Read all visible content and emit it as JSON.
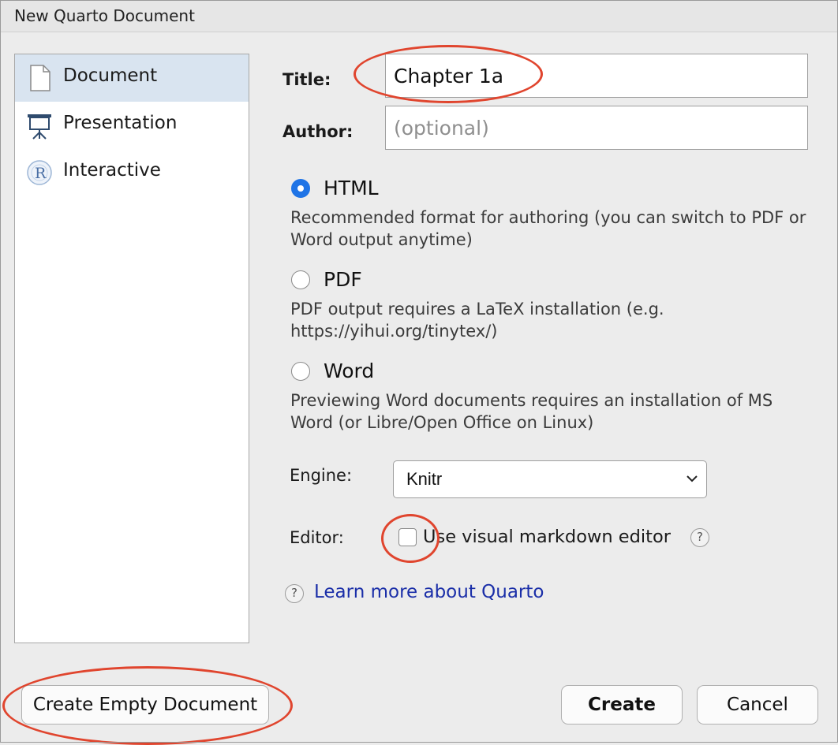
{
  "window": {
    "title": "New Quarto Document"
  },
  "sidebar": {
    "items": [
      {
        "label": "Document",
        "icon": "document-icon",
        "selected": true
      },
      {
        "label": "Presentation",
        "icon": "presentation-icon",
        "selected": false
      },
      {
        "label": "Interactive",
        "icon": "r-logo-icon",
        "selected": false
      }
    ]
  },
  "form": {
    "title_label": "Title:",
    "title_value": "Chapter 1a",
    "author_label": "Author:",
    "author_placeholder": "(optional)"
  },
  "formats": [
    {
      "name": "HTML",
      "checked": true,
      "description": "Recommended format for authoring (you can switch to PDF or Word output anytime)"
    },
    {
      "name": "PDF",
      "checked": false,
      "description": "PDF output requires a LaTeX installation (e.g. https://yihui.org/tinytex/)"
    },
    {
      "name": "Word",
      "checked": false,
      "description": "Previewing Word documents requires an installation of MS Word (or Libre/Open Office on Linux)"
    }
  ],
  "engine": {
    "label": "Engine:",
    "value": "Knitr"
  },
  "editor": {
    "label": "Editor:",
    "checkbox_label": "Use visual markdown editor",
    "checked": false,
    "help": "?"
  },
  "learn_more": {
    "help": "?",
    "label": "Learn more about Quarto"
  },
  "buttons": {
    "create_empty": "Create Empty Document",
    "create": "Create",
    "cancel": "Cancel"
  },
  "colors": {
    "accent": "#1f74e6",
    "link": "#1a2ea8",
    "annotation": "#e0452e",
    "selection": "#d9e4f0"
  }
}
